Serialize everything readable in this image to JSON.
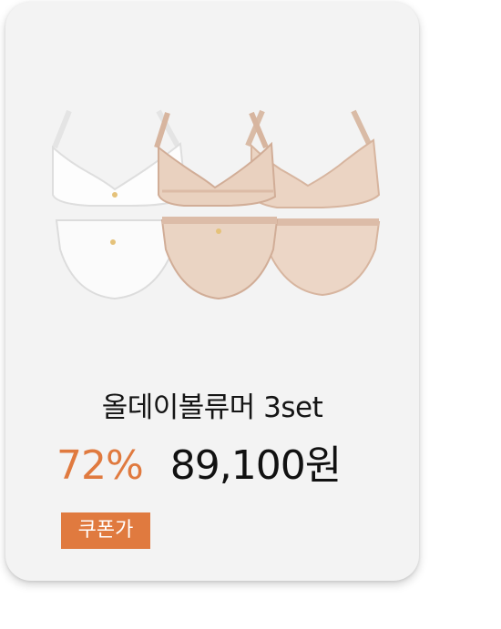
{
  "product": {
    "name": "올데이볼류머 3set",
    "discount": "72%",
    "price": "89,100원",
    "badge": "쿠폰가",
    "image_alt": "product-photo-3-bra-and-brief-sets-white-beige-beige"
  },
  "colors": {
    "accent": "#e07a3f",
    "card_bg": "#f3f3f3",
    "text": "#151515",
    "white_set": "#fbfbfb",
    "beige_set": "#ead3c1",
    "beige_trim": "#d7b59f"
  }
}
